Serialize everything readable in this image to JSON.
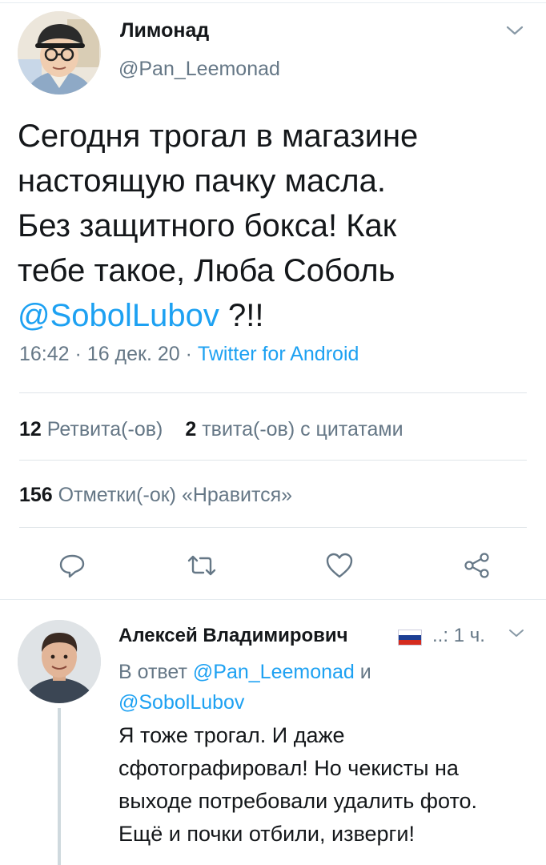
{
  "tweet": {
    "author_name": "Лимонад",
    "author_handle": "@Pan_Leemonad",
    "text_lines": [
      "Сегодня трогал в магазине",
      "настоящую пачку масла.",
      "Без защитного бокса! Как",
      "тебе такое, Люба Соболь"
    ],
    "mention": "@SobolLubov",
    "text_tail": " ?!!",
    "time": "16:42",
    "date": "16 дек. 20",
    "separator": "·",
    "source": "Twitter for Android",
    "retweets_count": "12",
    "retweets_label": "Ретвита(-ов)",
    "quotes_count": "2",
    "quotes_label": "твита(-ов) с цитатами",
    "likes_count": "156",
    "likes_label": "Отметки(-ок) «Нравится»",
    "actions": [
      "reply-icon",
      "retweet-icon",
      "like-icon",
      "share-icon"
    ]
  },
  "reply": {
    "author_name": "Алексей Владимирович",
    "flag_icon": "russian-flag-icon",
    "time": "1 ч.",
    "time_prefix": "..:",
    "reply_to_prefix": "В ответ",
    "reply_to_user1": "@Pan_Leemonad",
    "reply_to_and": "и",
    "reply_to_user2": "@SobolLubov",
    "text_lines": [
      "Я тоже трогал. И даже",
      "сфотографировал! Но чекисты на",
      "выходе потребовали удалить фото.",
      "Ещё и почки отбили, изверги!"
    ]
  },
  "colors": {
    "accent": "#1da1f2",
    "secondary_text": "#657786",
    "primary_text": "#14171a",
    "divider": "#e6ecf0"
  }
}
